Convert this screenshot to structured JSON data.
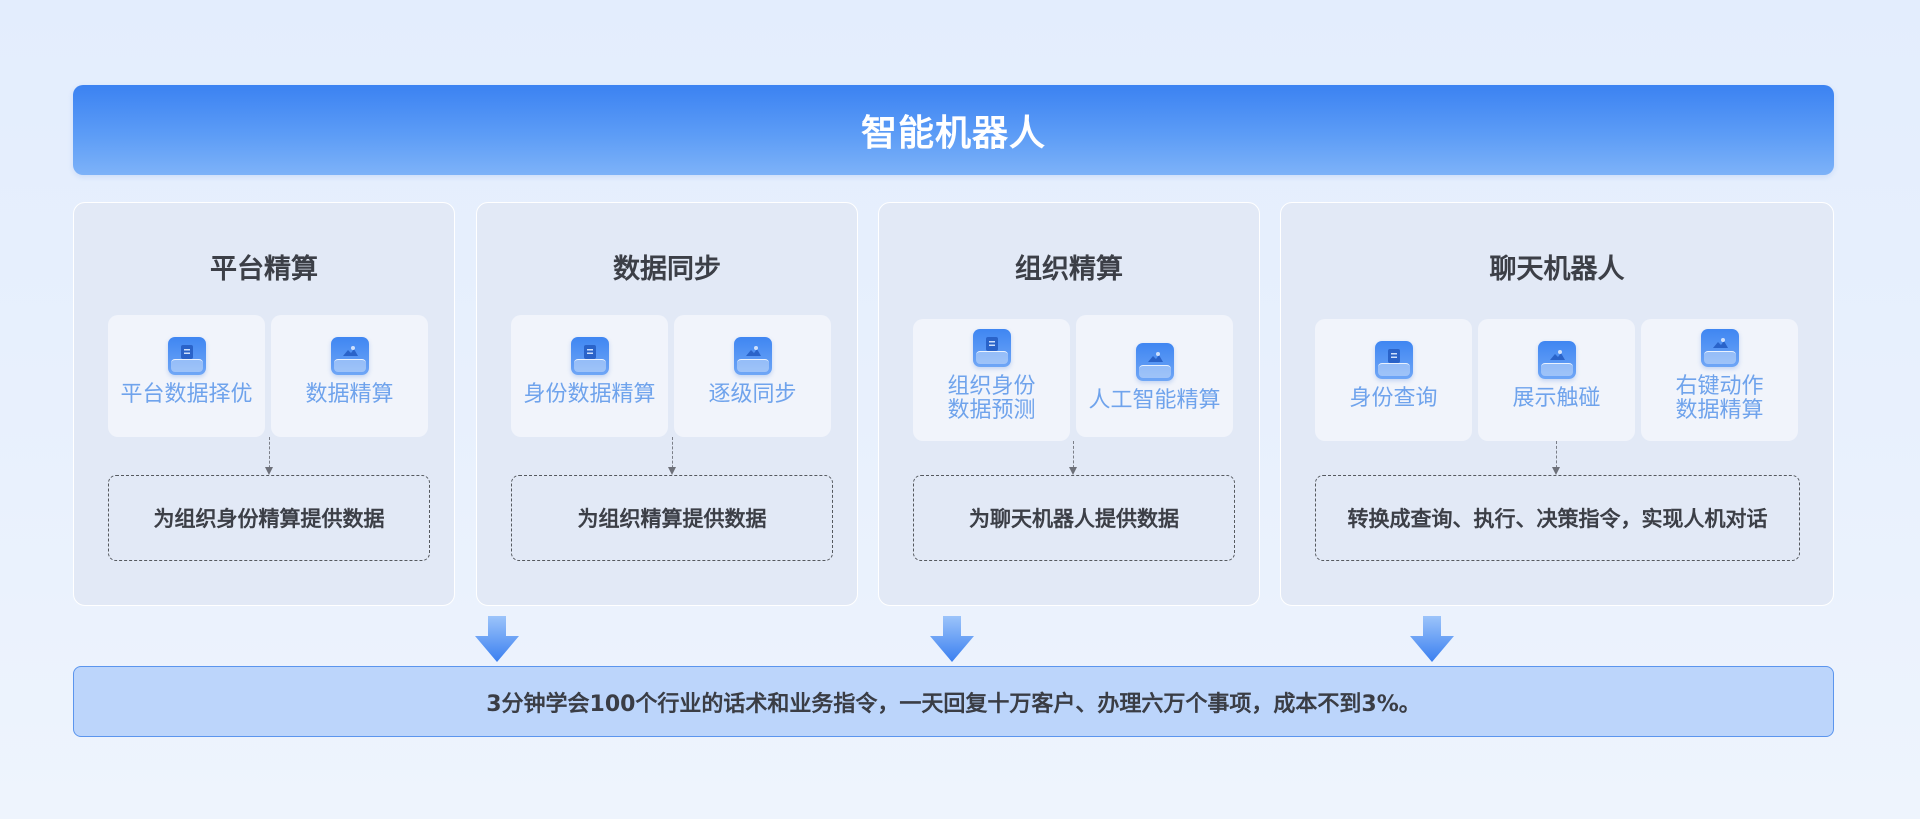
{
  "title": "智能机器人",
  "colors": {
    "accent": "#3b82f2",
    "card_label": "#6fa3ec",
    "footer_bg": "#bcd5fb"
  },
  "columns": [
    {
      "title": "平台精算",
      "items": [
        {
          "label": "平台数据择优",
          "icon": "document-icon"
        },
        {
          "label": "数据精算",
          "icon": "cloud-icon"
        }
      ],
      "result": "为组织身份精算提供数据"
    },
    {
      "title": "数据同步",
      "items": [
        {
          "label": "身份数据精算",
          "icon": "document-icon"
        },
        {
          "label": "逐级同步",
          "icon": "cloud-icon"
        }
      ],
      "result": "为组织精算提供数据"
    },
    {
      "title": "组织精算",
      "items": [
        {
          "label_line1": "组织身份",
          "label_line2": "数据预测",
          "icon": "document-icon"
        },
        {
          "label": "人工智能精算",
          "icon": "cloud-icon"
        }
      ],
      "result": "为聊天机器人提供数据"
    },
    {
      "title": "聊天机器人",
      "items": [
        {
          "label": "身份查询",
          "icon": "document-icon"
        },
        {
          "label": "展示触碰",
          "icon": "cloud-icon"
        },
        {
          "label_line1": "右键动作",
          "label_line2": "数据精算",
          "icon": "cloud-icon"
        }
      ],
      "result": "转换成查询、执行、决策指令，实现人机对话"
    }
  ],
  "footer": "3分钟学会100个行业的话术和业务指令，一天回复十万客户、办理六万个事项，成本不到3%。"
}
